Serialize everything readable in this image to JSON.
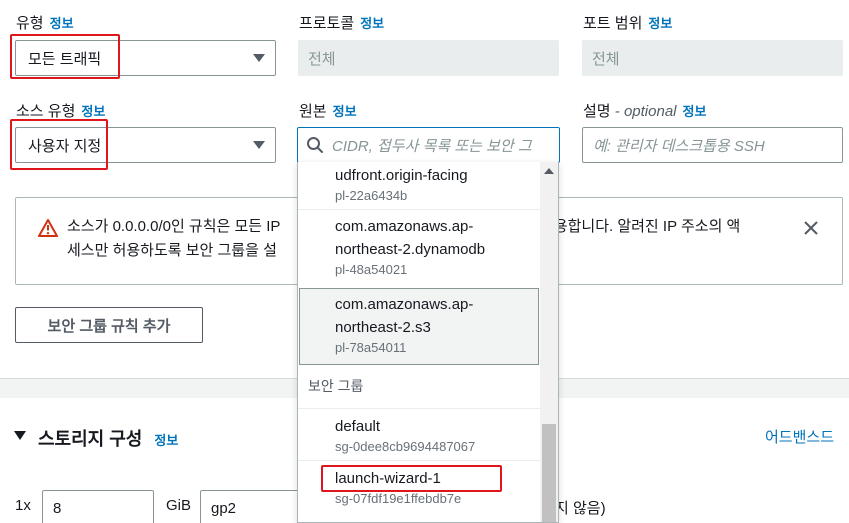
{
  "fields": {
    "type": {
      "label": "유형",
      "info": "정보",
      "value": "모든 트래픽"
    },
    "protocol": {
      "label": "프로토콜",
      "info": "정보",
      "value": "전체"
    },
    "port_range": {
      "label": "포트 범위",
      "info": "정보",
      "value": "전체"
    },
    "source_type": {
      "label": "소스 유형",
      "info": "정보",
      "value": "사용자 지정"
    },
    "source": {
      "label": "원본",
      "info": "정보",
      "placeholder": "CIDR, 접두사 목록 또는 보안 그"
    },
    "description": {
      "label": "설명",
      "optional": "- optional",
      "info": "정보",
      "placeholder": "예: 관리자 데스크톱용 SSH"
    }
  },
  "alert": {
    "line1_left": "소스가 0.0.0.0/0인 규칙은 모든 IP",
    "line1_right": "허용합니다. 알려진 IP 주소의 액",
    "line2_left": "세스만 허용하도록 보안 그룹을 설"
  },
  "add_rule_button": "보안 그룹 규칙 추가",
  "storage": {
    "title": "스토리지 구성",
    "info": "정보",
    "advanced": "어드밴스드",
    "count": "1x",
    "size": "8",
    "unit": "GiB",
    "volume_type": "gp2",
    "trailing_text": "지 않음)"
  },
  "dropdown": {
    "items": [
      {
        "title": "udfront.origin-facing",
        "sub": "pl-22a6434b"
      },
      {
        "title": "com.amazonaws.ap-",
        "title2": "northeast-2.dynamodb",
        "sub": "pl-48a54021"
      },
      {
        "title": "com.amazonaws.ap-",
        "title2": "northeast-2.s3",
        "sub": "pl-78a54011"
      }
    ],
    "group_label": "보안 그룹",
    "groups": [
      {
        "title": "default",
        "sub": "sg-0dee8cb9694487067"
      },
      {
        "title": "launch-wizard-1",
        "sub": "sg-07fdf19e1ffebdb7e"
      }
    ]
  },
  "colors": {
    "highlight": "#e0161d",
    "link": "#0073bb",
    "warning": "#d13212"
  }
}
